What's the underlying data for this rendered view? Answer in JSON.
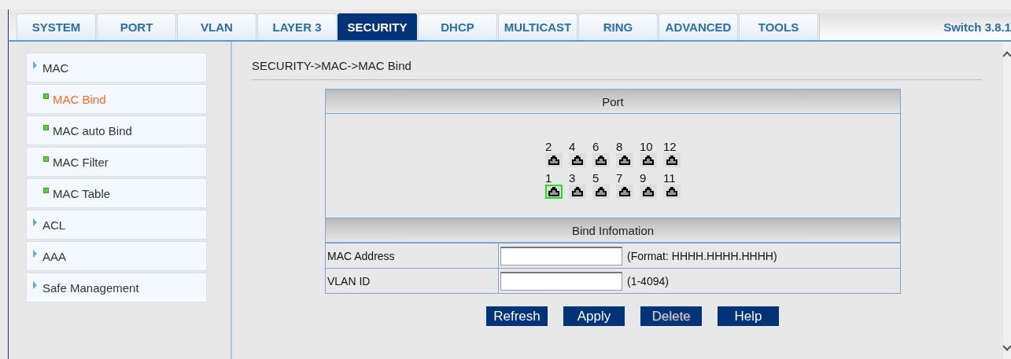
{
  "tabs": [
    {
      "label": "SYSTEM",
      "selected": false
    },
    {
      "label": "PORT",
      "selected": false
    },
    {
      "label": "VLAN",
      "selected": false
    },
    {
      "label": "LAYER 3",
      "selected": false
    },
    {
      "label": "SECURITY",
      "selected": true
    },
    {
      "label": "DHCP",
      "selected": false
    },
    {
      "label": "MULTICAST",
      "selected": false
    },
    {
      "label": "RING",
      "selected": false
    },
    {
      "label": "ADVANCED",
      "selected": false
    },
    {
      "label": "TOOLS",
      "selected": false
    }
  ],
  "version": "Switch 3.8.1",
  "sidebar": {
    "items": [
      {
        "label": "MAC",
        "selected": false,
        "children": [
          {
            "label": "MAC Bind",
            "selected": true
          },
          {
            "label": "MAC auto Bind",
            "selected": false
          },
          {
            "label": "MAC Filter",
            "selected": false
          },
          {
            "label": "MAC Table",
            "selected": false
          }
        ]
      },
      {
        "label": "ACL",
        "selected": false
      },
      {
        "label": "AAA",
        "selected": false
      },
      {
        "label": "Safe Management",
        "selected": false
      }
    ]
  },
  "breadcrumb": "SECURITY->MAC->MAC Bind",
  "port_panel": {
    "title": "Port",
    "rows": [
      [
        {
          "label": "2",
          "selected": false
        },
        {
          "label": "4",
          "selected": false
        },
        {
          "label": "6",
          "selected": false
        },
        {
          "label": "8",
          "selected": false
        },
        {
          "label": "10",
          "selected": false
        },
        {
          "label": "12",
          "selected": false
        }
      ],
      [
        {
          "label": "1",
          "selected": true
        },
        {
          "label": "3",
          "selected": false
        },
        {
          "label": "5",
          "selected": false
        },
        {
          "label": "7",
          "selected": false
        },
        {
          "label": "9",
          "selected": false
        },
        {
          "label": "11",
          "selected": false
        }
      ]
    ]
  },
  "bind_panel": {
    "title": "Bind Infomation",
    "fields": [
      {
        "label": "MAC Address",
        "hint": "(Format: HHHH.HHHH.HHHH)"
      },
      {
        "label": "VLAN ID",
        "hint": "(1-4094)"
      }
    ]
  },
  "buttons": [
    {
      "label": "Refresh",
      "disabled": false
    },
    {
      "label": "Apply",
      "disabled": false
    },
    {
      "label": "Delete",
      "disabled": true
    },
    {
      "label": "Help",
      "disabled": false
    }
  ]
}
